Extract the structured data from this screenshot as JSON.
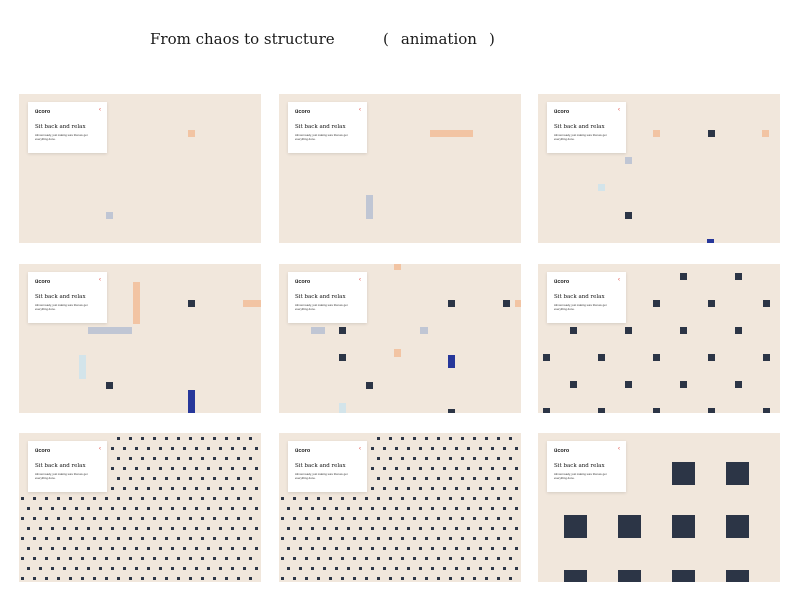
{
  "header": {
    "title": "From chaos to structure",
    "paren_open": "(",
    "subtitle": "animation",
    "paren_close": ")"
  },
  "card": {
    "logo": "ücoro",
    "close_icon": "close-icon",
    "heading": "Sit back and relax",
    "body": "Almost ready, just making sure that we get everything done."
  },
  "colors": {
    "background": "#f1e7dc",
    "navy": "#2c3546",
    "peach": "#f2c4a3",
    "grey": "#c0c6d4",
    "lightblue": "#d3e4ea",
    "blue": "#27379a",
    "close": "#e0423a"
  },
  "frames_count": 9
}
